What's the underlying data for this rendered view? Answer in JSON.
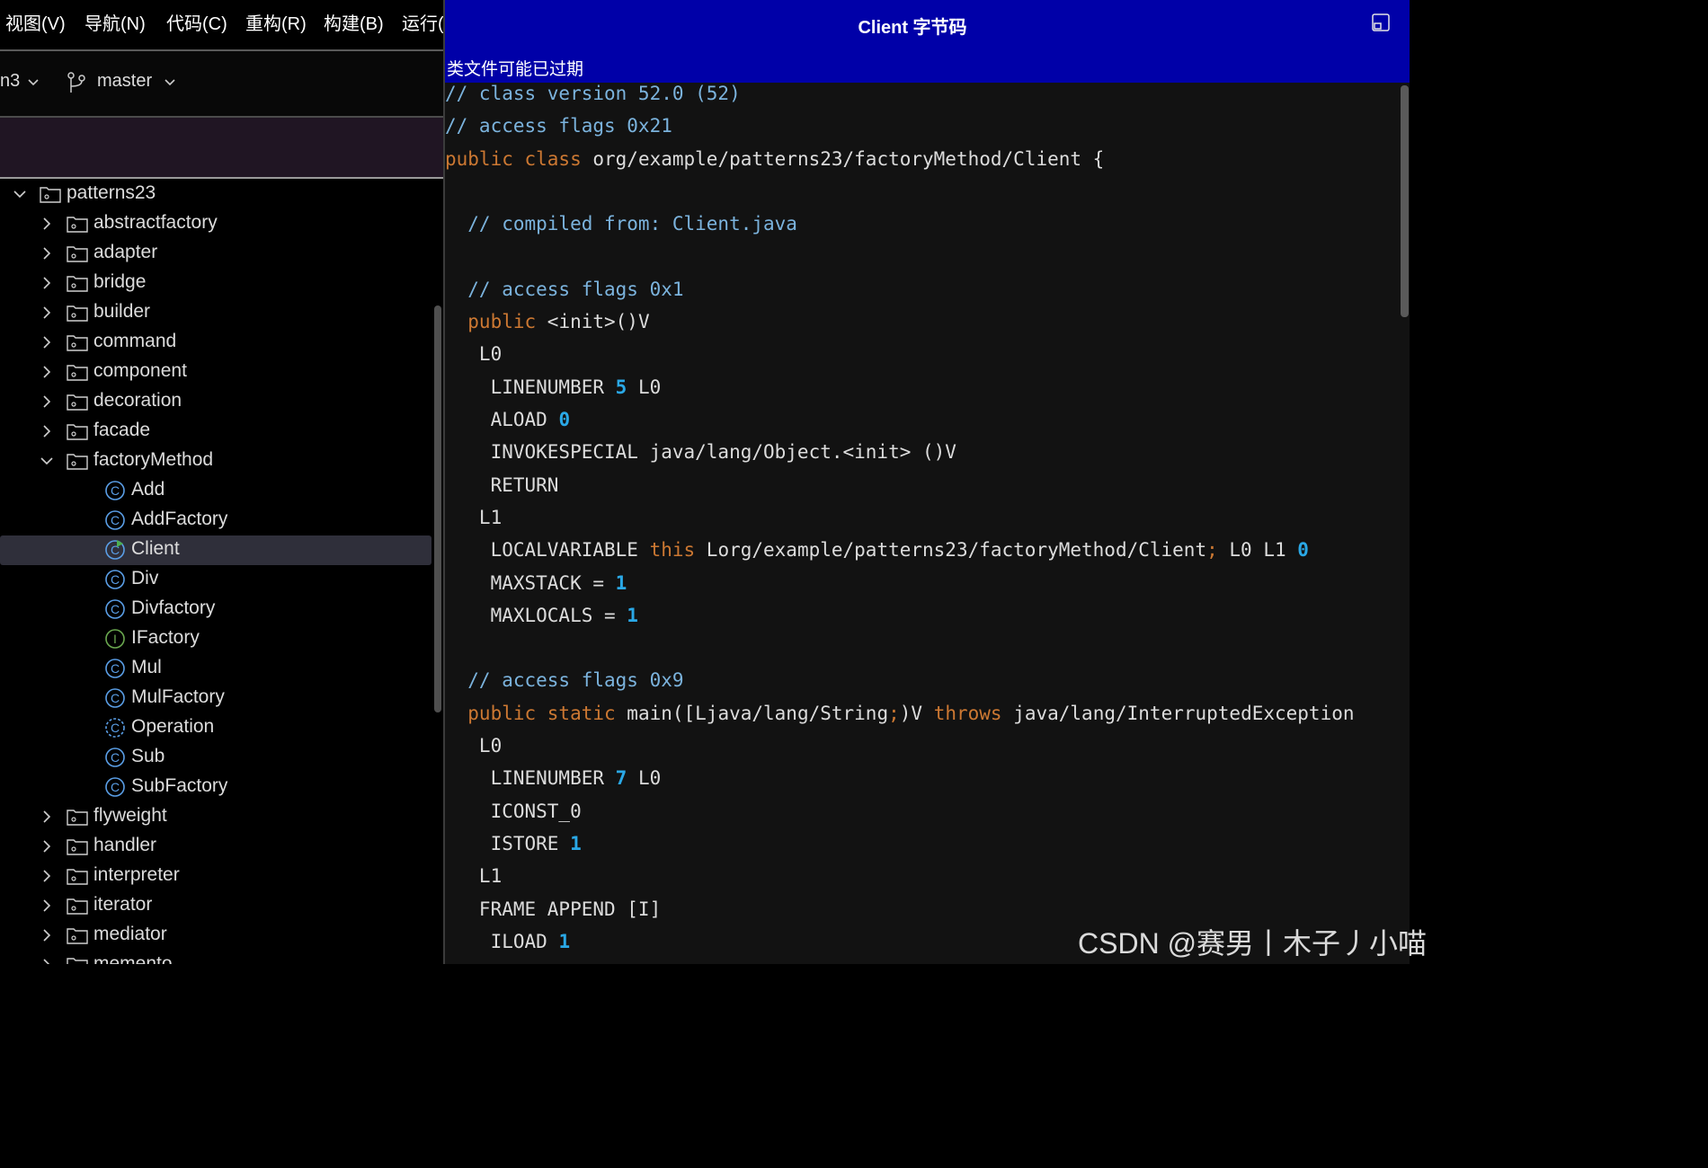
{
  "menu": [
    "视图(V)",
    "导航(N)",
    "代码(C)",
    "重构(R)",
    "构建(B)",
    "运行("
  ],
  "toolbar": {
    "project_fragment": "n3",
    "branch": "master"
  },
  "tree": [
    {
      "label": "patterns23",
      "kind": "folder",
      "state": "expanded"
    },
    {
      "label": "abstractfactory",
      "kind": "folder",
      "state": "collapsed"
    },
    {
      "label": "adapter",
      "kind": "folder",
      "state": "collapsed"
    },
    {
      "label": "bridge",
      "kind": "folder",
      "state": "collapsed"
    },
    {
      "label": "builder",
      "kind": "folder",
      "state": "collapsed"
    },
    {
      "label": "command",
      "kind": "folder",
      "state": "collapsed"
    },
    {
      "label": "component",
      "kind": "folder",
      "state": "collapsed"
    },
    {
      "label": "decoration",
      "kind": "folder",
      "state": "collapsed"
    },
    {
      "label": "facade",
      "kind": "folder",
      "state": "collapsed"
    },
    {
      "label": "factoryMethod",
      "kind": "folder",
      "state": "expanded"
    },
    {
      "label": "Add",
      "kind": "class",
      "badge": "C"
    },
    {
      "label": "AddFactory",
      "kind": "class",
      "badge": "C"
    },
    {
      "label": "Client",
      "kind": "class",
      "badge": "C",
      "selected": true,
      "runnable": true
    },
    {
      "label": "Div",
      "kind": "class",
      "badge": "C"
    },
    {
      "label": "Divfactory",
      "kind": "class",
      "badge": "C"
    },
    {
      "label": "IFactory",
      "kind": "interface",
      "badge": "I"
    },
    {
      "label": "Mul",
      "kind": "class",
      "badge": "C"
    },
    {
      "label": "MulFactory",
      "kind": "class",
      "badge": "C"
    },
    {
      "label": "Operation",
      "kind": "class",
      "badge": "C",
      "abstract": true
    },
    {
      "label": "Sub",
      "kind": "class",
      "badge": "C"
    },
    {
      "label": "SubFactory",
      "kind": "class",
      "badge": "C"
    },
    {
      "label": "flyweight",
      "kind": "folder",
      "state": "collapsed"
    },
    {
      "label": "handler",
      "kind": "folder",
      "state": "collapsed"
    },
    {
      "label": "interpreter",
      "kind": "folder",
      "state": "collapsed"
    },
    {
      "label": "iterator",
      "kind": "folder",
      "state": "collapsed"
    },
    {
      "label": "mediator",
      "kind": "folder",
      "state": "collapsed"
    },
    {
      "label": "memento",
      "kind": "folder",
      "state": "collapsed"
    }
  ],
  "bytecode_window": {
    "title": "Client 字节码",
    "notice": "类文件可能已过期",
    "lines": [
      [
        [
          "// class version 52.0 (52)",
          "cm"
        ]
      ],
      [
        [
          "// access flags 0x21",
          "cm"
        ]
      ],
      [
        [
          "public class ",
          "kw"
        ],
        [
          "org/example/patterns23/factoryMethod/Client {",
          ""
        ]
      ],
      [],
      [
        [
          "  // compiled from: Client.java",
          "cm"
        ]
      ],
      [],
      [
        [
          "  // access flags 0x1",
          "cm"
        ]
      ],
      [
        [
          "  public ",
          "kw"
        ],
        [
          "<init>()V",
          ""
        ]
      ],
      [
        [
          "   L0",
          ""
        ]
      ],
      [
        [
          "    LINENUMBER ",
          ""
        ],
        [
          "5",
          "num"
        ],
        [
          " L0",
          ""
        ]
      ],
      [
        [
          "    ALOAD ",
          ""
        ],
        [
          "0",
          "num"
        ]
      ],
      [
        [
          "    INVOKESPECIAL java/lang/Object.<init> ()V",
          ""
        ]
      ],
      [
        [
          "    RETURN",
          ""
        ]
      ],
      [
        [
          "   L1",
          ""
        ]
      ],
      [
        [
          "    LOCALVARIABLE ",
          ""
        ],
        [
          "this",
          "kw"
        ],
        [
          " Lorg/example/patterns23/factoryMethod/Client",
          ""
        ],
        [
          ";",
          "kw"
        ],
        [
          " L0 L1 ",
          ""
        ],
        [
          "0",
          "num"
        ]
      ],
      [
        [
          "    MAXSTACK = ",
          ""
        ],
        [
          "1",
          "num"
        ]
      ],
      [
        [
          "    MAXLOCALS = ",
          ""
        ],
        [
          "1",
          "num"
        ]
      ],
      [],
      [
        [
          "  // access flags 0x9",
          "cm"
        ]
      ],
      [
        [
          "  public static ",
          "kw"
        ],
        [
          "main([Ljava/lang/String",
          ""
        ],
        [
          ";",
          "kw"
        ],
        [
          ")V ",
          ""
        ],
        [
          "throws ",
          "kw"
        ],
        [
          "java/lang/InterruptedException",
          ""
        ]
      ],
      [
        [
          "   L0",
          ""
        ]
      ],
      [
        [
          "    LINENUMBER ",
          ""
        ],
        [
          "7",
          "num"
        ],
        [
          " L0",
          ""
        ]
      ],
      [
        [
          "    ICONST_0",
          ""
        ]
      ],
      [
        [
          "    ISTORE ",
          ""
        ],
        [
          "1",
          "num"
        ]
      ],
      [
        [
          "   L1",
          ""
        ]
      ],
      [
        [
          "   FRAME APPEND [I]",
          ""
        ]
      ],
      [
        [
          "    ILOAD ",
          ""
        ],
        [
          "1",
          "num"
        ]
      ]
    ]
  },
  "watermark": "CSDN @赛男丨木子丿小喵",
  "colors": {
    "title_bar": "#0000a8",
    "comment": "#7bb3dd",
    "keyword": "#cc7832",
    "number": "#2aa8e6",
    "class_icon": "#5a9ee6",
    "interface_icon": "#6aa84f"
  }
}
